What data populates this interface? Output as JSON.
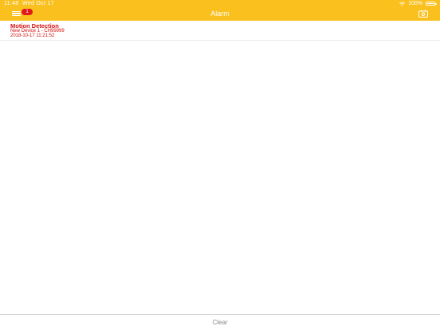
{
  "status_bar": {
    "time": "11:48  Wed Oct 17",
    "battery": "100%",
    "battery_level": 1.0
  },
  "nav": {
    "title": "Alarm",
    "menu_badge": "1"
  },
  "alarms": [
    {
      "title": "Motion Detection",
      "device": "New Device 1 - CH99999",
      "timestamp": "2018-10-17 11:21:52"
    }
  ],
  "footer": {
    "clear_label": "Clear"
  },
  "colors": {
    "accent": "#f9c01e",
    "alarm_text": "#d40f0f",
    "badge": "#e0191b"
  }
}
